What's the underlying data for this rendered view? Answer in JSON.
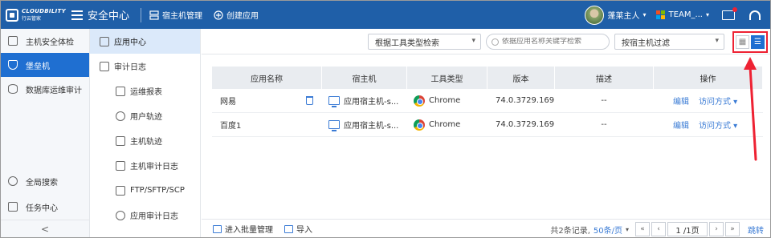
{
  "topbar": {
    "logo_text": "CLOUDBILITY",
    "logo_sub": "行云管家",
    "title": "安全中心",
    "host_manage": "宿主机管理",
    "create_app": "创建应用",
    "user_name": "蓬莱主人",
    "team_name": "TEAM_..."
  },
  "leftnav": {
    "items": [
      {
        "label": "主机安全体检",
        "icon": "monitor-icon"
      },
      {
        "label": "堡垒机",
        "icon": "shield-icon"
      },
      {
        "label": "数据库运维审计",
        "icon": "database-icon"
      }
    ],
    "bottom": [
      {
        "label": "全局搜索",
        "icon": "search-icon"
      },
      {
        "label": "任务中心",
        "icon": "task-icon"
      }
    ],
    "collapse": "<"
  },
  "subnav": {
    "items": [
      {
        "label": "应用中心",
        "level": 1
      },
      {
        "label": "审计日志",
        "level": 1
      },
      {
        "label": "运维报表",
        "level": 2
      },
      {
        "label": "用户轨迹",
        "level": 2
      },
      {
        "label": "主机轨迹",
        "level": 2
      },
      {
        "label": "主机审计日志",
        "level": 2
      },
      {
        "label": "FTP/SFTP/SCP",
        "level": 2
      },
      {
        "label": "应用审计日志",
        "level": 2
      }
    ]
  },
  "toolbar": {
    "tool_type_select": "根据工具类型检索",
    "search_placeholder": "依据应用名称关键字检索",
    "host_filter": "按宿主机过滤"
  },
  "table": {
    "headers": [
      "应用名称",
      "宿主机",
      "工具类型",
      "版本",
      "描述",
      "操作"
    ],
    "rows": [
      {
        "name": "网易",
        "host": "应用宿主机-s...",
        "tool": "Chrome",
        "version": "74.0.3729.169",
        "desc": "--",
        "edit": "编辑",
        "access": "访问方式"
      },
      {
        "name": "百度1",
        "host": "应用宿主机-s...",
        "tool": "Chrome",
        "version": "74.0.3729.169",
        "desc": "--",
        "edit": "编辑",
        "access": "访问方式"
      }
    ]
  },
  "footer": {
    "batch": "进入批量管理",
    "import": "导入",
    "total": "共2条记录,",
    "page_size": "50条/页",
    "page": "1 /1页",
    "jump": "跳转"
  },
  "colors": {
    "primary": "#1f5fa8",
    "accent": "#1f6fd1",
    "annotation": "#e23"
  }
}
